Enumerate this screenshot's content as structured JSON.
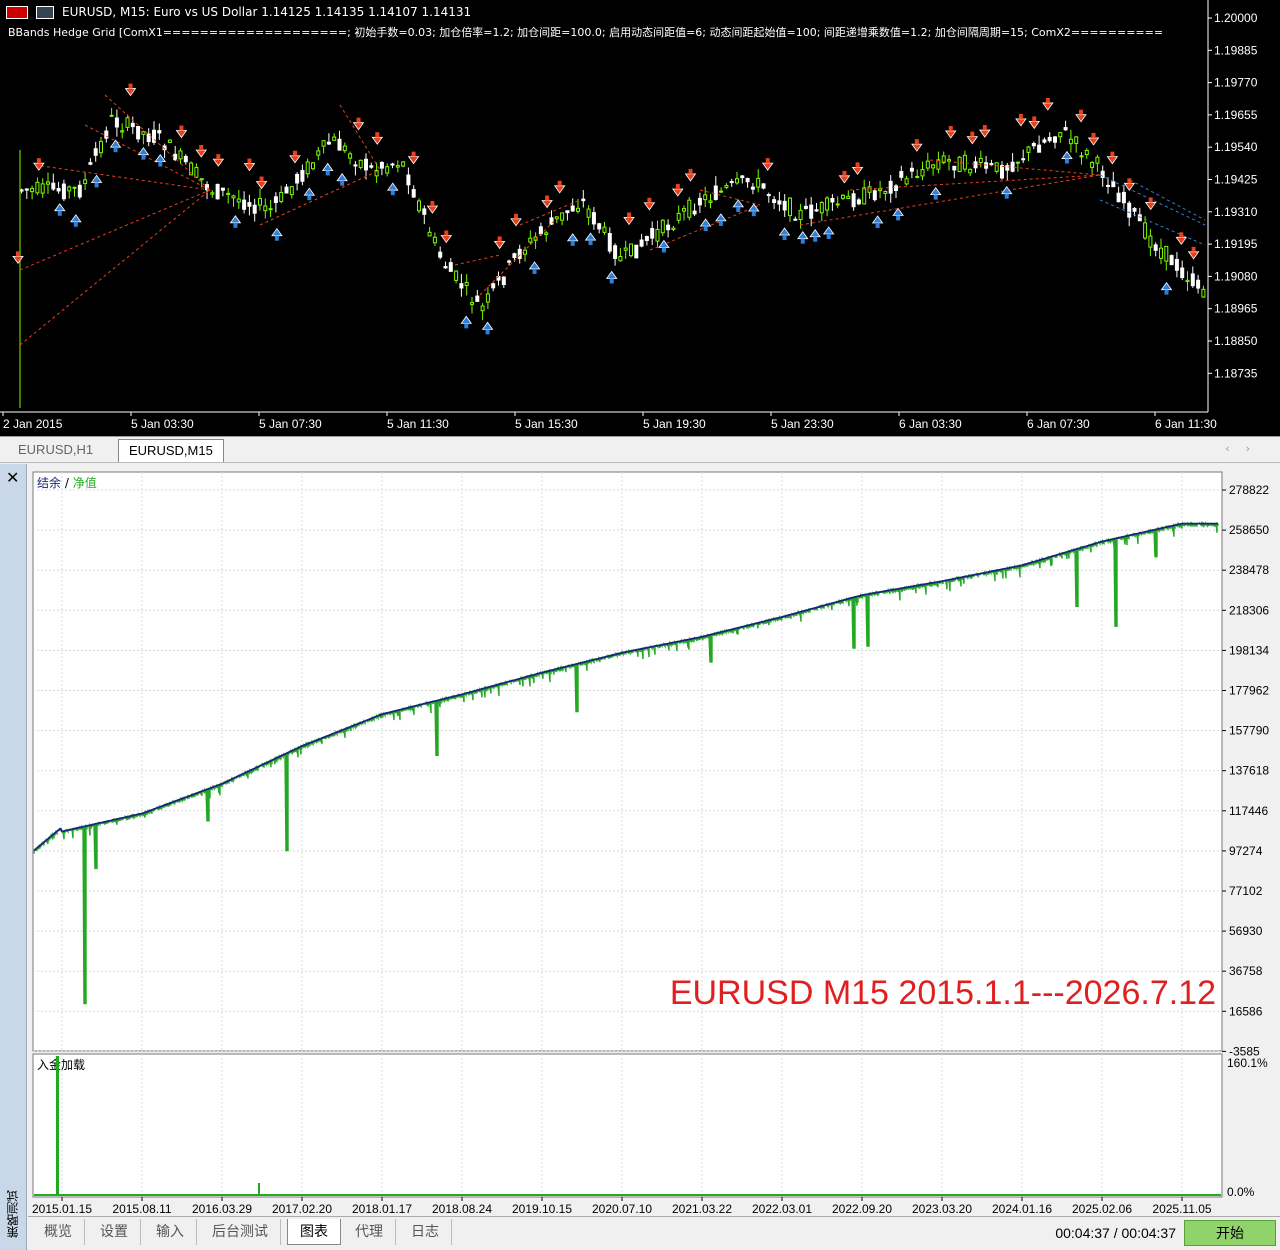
{
  "top_chart": {
    "title": "EURUSD, M15:  Euro vs US Dollar  1.14125 1.14135 1.14107 1.14131",
    "indicator": "BBands Hedge Grid [ComX1====================; 初始手数=0.03; 加仓倍率=1.2; 加仓间距=100.0; 启用动态间距值=6; 动态间距起始值=100; 间距递增乘数值=1.2; 加仓间隔周期=15; ComX2==========",
    "price_labels": [
      "1.20000",
      "1.19885",
      "1.19770",
      "1.19655",
      "1.19540",
      "1.19425",
      "1.19310",
      "1.19195",
      "1.19080",
      "1.18965",
      "1.18850",
      "1.18735"
    ],
    "time_labels": [
      "2 Jan 2015",
      "5 Jan 03:30",
      "5 Jan 07:30",
      "5 Jan 11:30",
      "5 Jan 15:30",
      "5 Jan 19:30",
      "5 Jan 23:30",
      "6 Jan 03:30",
      "6 Jan 07:30",
      "6 Jan 11:30"
    ],
    "colors": {
      "background": "#000000",
      "bull_candle": "#7CFC00",
      "bear_candle": "#FFFFFF",
      "sell_marker": "#E8401C",
      "buy_marker": "#2F7FD8",
      "trade_line": "#E8401C",
      "text": "#FFFFFF"
    }
  },
  "chart_tabs": [
    {
      "label": "EURUSD,H1",
      "active": false
    },
    {
      "label": "EURUSD,M15",
      "active": true
    }
  ],
  "tester": {
    "side_label": "策略测试",
    "legend_balance": "结余",
    "legend_sep": " / ",
    "legend_equity": "净值",
    "overlay_text": "EURUSD M15 2015.1.1---2026.7.12",
    "deposit_label": "入金加载",
    "deposit_max_label": "160.1%",
    "deposit_min_label": "0.0%",
    "y_labels": [
      "278822",
      "258650",
      "238478",
      "218306",
      "198134",
      "177962",
      "157790",
      "137618",
      "117446",
      "97274",
      "77102",
      "56930",
      "36758",
      "16586",
      "-3585"
    ],
    "x_labels": [
      "2015.01.15",
      "2015.08.11",
      "2016.03.29",
      "2017.02.20",
      "2018.01.17",
      "2018.08.24",
      "2019.10.15",
      "2020.07.10",
      "2021.03.22",
      "2022.03.01",
      "2022.09.20",
      "2023.03.20",
      "2024.01.16",
      "2025.02.06",
      "2025.11.05"
    ],
    "colors": {
      "balance": "#1A237E",
      "equity": "#22A822",
      "overlay": "#E02020",
      "grid": "#D8D8D8"
    }
  },
  "chart_data": {
    "type": "line",
    "title": "",
    "ylim": [
      -3585,
      288000
    ],
    "x": [
      "2015.01.15",
      "2015.08.11",
      "2016.03.29",
      "2017.02.20",
      "2018.01.17",
      "2018.08.24",
      "2019.10.15",
      "2020.07.10",
      "2021.03.22",
      "2022.03.01",
      "2022.09.20",
      "2023.03.20",
      "2024.01.16",
      "2025.02.06",
      "2025.11.05"
    ],
    "series": [
      {
        "name": "结余",
        "values": [
          107000,
          116000,
          131000,
          150000,
          166000,
          176000,
          187000,
          197000,
          205000,
          215000,
          226000,
          233000,
          241000,
          253000,
          262000
        ]
      },
      {
        "name": "净值",
        "values": [
          20000,
          112000,
          97000,
          148000,
          145000,
          175000,
          167000,
          196000,
          199000,
          200000,
          223000,
          232000,
          228000,
          210000,
          260000
        ]
      }
    ]
  },
  "bottom_tabs": [
    "概览",
    "设置",
    "输入",
    "后台测试",
    "图表",
    "代理",
    "日志"
  ],
  "active_bottom_tab": "图表",
  "timer": "00:04:37 / 00:04:37",
  "start_button": "开始"
}
